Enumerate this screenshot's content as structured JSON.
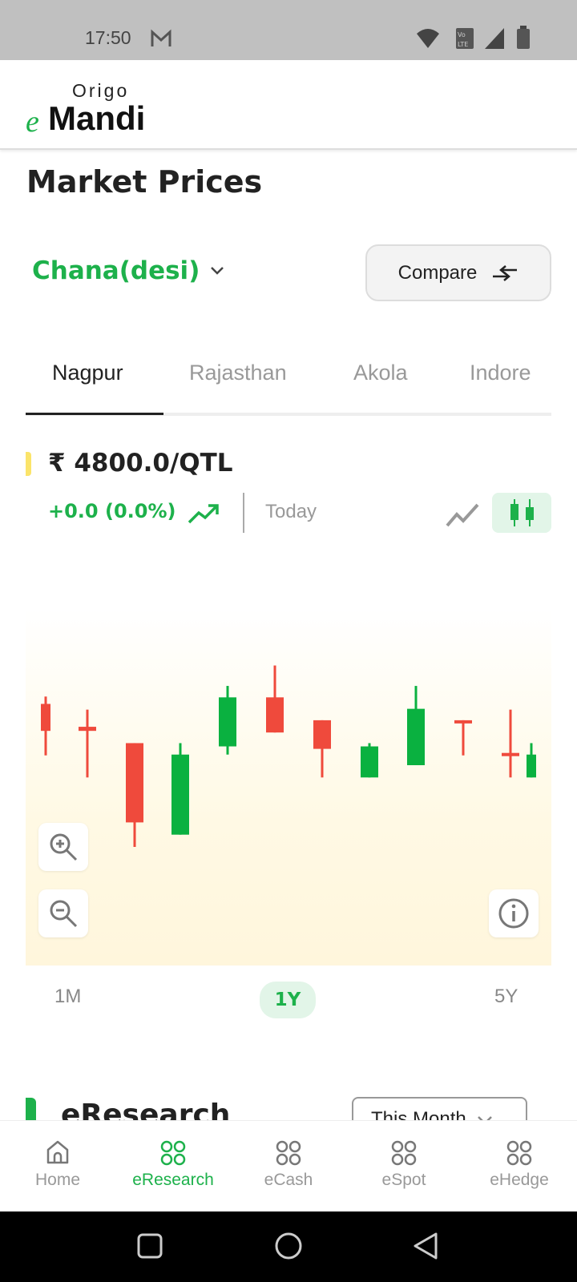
{
  "status_bar": {
    "time": "17:50",
    "icons": [
      "gmail-icon",
      "wifi-icon",
      "volte-icon",
      "signal-icon",
      "battery-icon"
    ]
  },
  "logo": {
    "top": "Origo",
    "e": "e",
    "brand": "Mandi"
  },
  "page_title": "Market Prices",
  "commodity": {
    "selected": "Chana(desi)"
  },
  "compare_label": "Compare",
  "tabs": [
    {
      "label": "Nagpur",
      "active": true
    },
    {
      "label": "Rajasthan"
    },
    {
      "label": "Akola"
    },
    {
      "label": "Indore"
    }
  ],
  "price": {
    "value": "₹ 4800.0/QTL",
    "change": "+0.0 (0.0%)",
    "period": "Today"
  },
  "chart_type": {
    "options": [
      "line",
      "candlestick"
    ],
    "selected": "candlestick"
  },
  "colors": {
    "accent": "#1db14b",
    "up": "#0ab140",
    "down": "#ef4a3c"
  },
  "chart_data": {
    "type": "candlestick",
    "note_scale": "relative",
    "candles": [
      {
        "o": 225,
        "h": 234,
        "l": 162,
        "c": 192,
        "dir": "down"
      },
      {
        "o": 197,
        "h": 218,
        "l": 135,
        "c": 192,
        "dir": "down"
      },
      {
        "o": 177,
        "h": 177,
        "l": 50,
        "c": 80,
        "dir": "down"
      },
      {
        "o": 65,
        "h": 177,
        "l": 65,
        "c": 163,
        "dir": "up"
      },
      {
        "o": 173,
        "h": 247,
        "l": 163,
        "c": 233,
        "dir": "up"
      },
      {
        "o": 233,
        "h": 272,
        "l": 190,
        "c": 190,
        "dir": "down"
      },
      {
        "o": 205,
        "h": 205,
        "l": 135,
        "c": 170,
        "dir": "down"
      },
      {
        "o": 135,
        "h": 177,
        "l": 135,
        "c": 173,
        "dir": "up"
      },
      {
        "o": 150,
        "h": 247,
        "l": 150,
        "c": 219,
        "dir": "up"
      },
      {
        "o": 205,
        "h": 205,
        "l": 162,
        "c": 202,
        "dir": "down"
      },
      {
        "o": 165,
        "h": 218,
        "l": 135,
        "c": 162,
        "dir": "down"
      },
      {
        "o": 135,
        "h": 177,
        "l": 135,
        "c": 163,
        "dir": "up"
      }
    ]
  },
  "timeframes": [
    {
      "label": "1M"
    },
    {
      "label": "1Y",
      "active": true
    },
    {
      "label": "5Y"
    }
  ],
  "eresearch": {
    "title": "eResearch",
    "filter": "This Month"
  },
  "bottom_nav": [
    {
      "label": "Home",
      "icon": "home-icon"
    },
    {
      "label": "eResearch",
      "icon": "grid-icon",
      "active": true
    },
    {
      "label": "eCash",
      "icon": "grid-icon"
    },
    {
      "label": "eSpot",
      "icon": "grid-icon"
    },
    {
      "label": "eHedge",
      "icon": "grid-icon"
    }
  ]
}
